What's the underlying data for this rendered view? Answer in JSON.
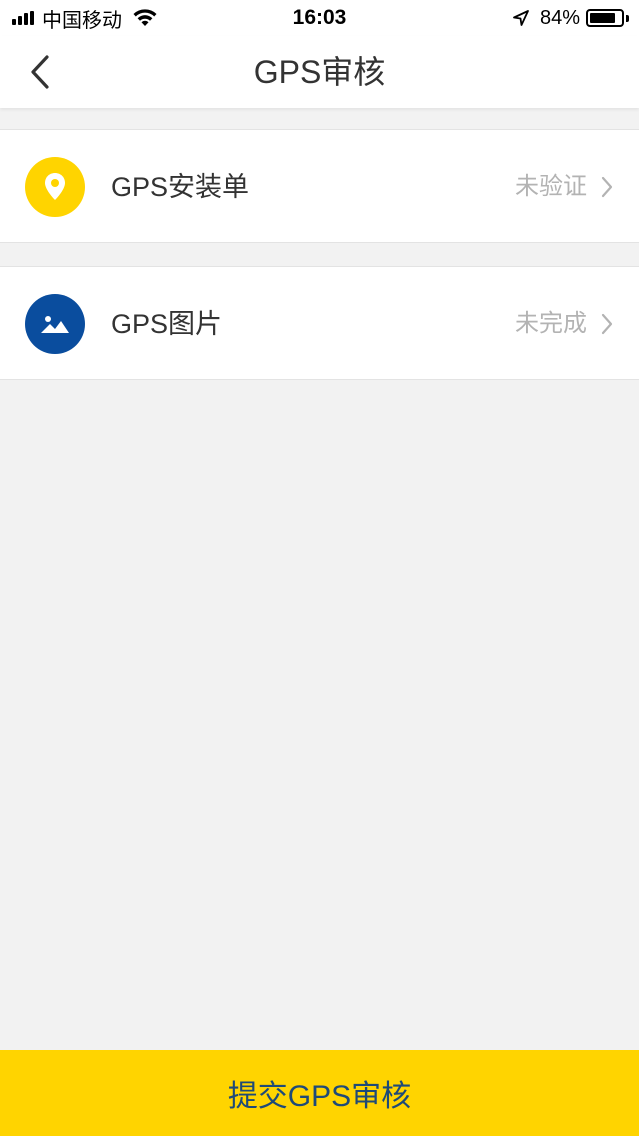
{
  "status_bar": {
    "carrier": "中国移动",
    "time": "16:03",
    "battery_percent": "84%",
    "battery_level": 0.84,
    "icons": [
      "signal-icon",
      "wifi-icon",
      "location-arrow-icon",
      "battery-icon"
    ]
  },
  "nav": {
    "title": "GPS审核",
    "back_icon": "chevron-left-icon"
  },
  "items": [
    {
      "label": "GPS安装单",
      "status": "未验证",
      "icon": "location-pin-icon",
      "icon_bg": "#ffd400"
    },
    {
      "label": "GPS图片",
      "status": "未完成",
      "icon": "image-icon",
      "icon_bg": "#0a4d9e"
    }
  ],
  "submit": {
    "label": "提交GPS审核",
    "background": "#ffd400",
    "text_color": "#1e4a78"
  },
  "colors": {
    "page_bg": "#f2f2f2",
    "status_text": "#b3b3b3"
  }
}
